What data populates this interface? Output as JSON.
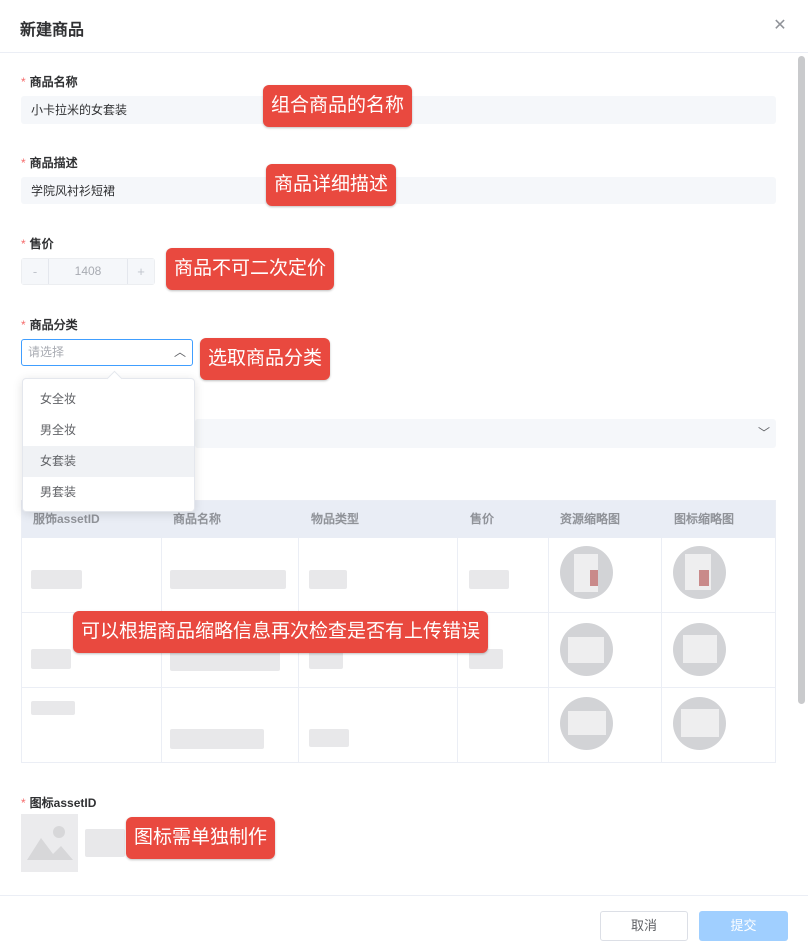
{
  "dialog": {
    "title": "新建商品",
    "close_icon": "close-icon",
    "scrollbar_position": 0.0
  },
  "form": {
    "name": {
      "label": "商品名称",
      "required_mark": "*",
      "value": "小卡拉米的女套装"
    },
    "description": {
      "label": "商品描述",
      "required_mark": "*",
      "value": "学院风衬衫短裙"
    },
    "price": {
      "label": "售价",
      "required_mark": "*",
      "value": "1408",
      "minus_label": "-",
      "plus_label": "+"
    },
    "category": {
      "label": "商品分类",
      "required_mark": "*",
      "placeholder": "请选择",
      "arrow_icon": "chevron-up-icon",
      "options": [
        "女全妆",
        "男全妆",
        "女套装",
        "男套装"
      ],
      "hovered_option": "女套装"
    },
    "second_select_icon": "chevron-down-icon",
    "icon_asset": {
      "label": "图标assetID",
      "required_mark": "*",
      "image_icon": "image-placeholder-icon"
    }
  },
  "table": {
    "columns": [
      "服饰assetID",
      "商品名称",
      "物品类型",
      "售价",
      "资源缩略图",
      "图标缩略图"
    ]
  },
  "callouts": {
    "name": "组合商品的名称",
    "description": "商品详细描述",
    "price": "商品不可二次定价",
    "category": "选取商品分类",
    "table": "可以根据商品缩略信息再次检查是否有上传错误",
    "icon": "图标需单独制作"
  },
  "footer": {
    "cancel_label": "取消",
    "submit_label": "提交"
  },
  "colors": {
    "required": "#f56c6c",
    "callout_bg": "#e9493f",
    "focus_border": "#409eff",
    "submit_bg": "#a0cfff"
  }
}
